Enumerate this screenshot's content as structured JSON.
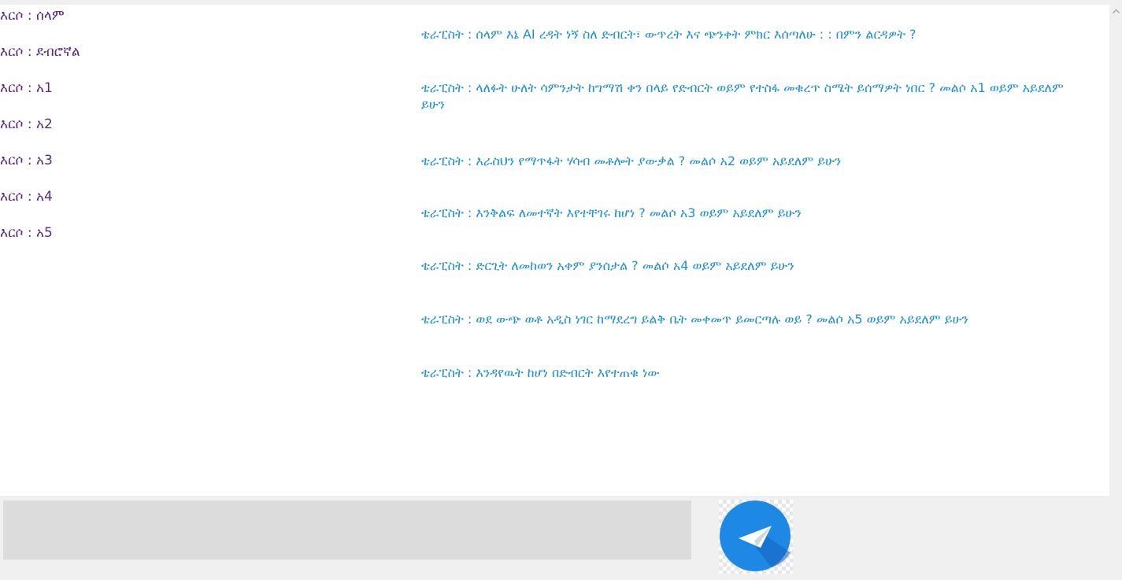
{
  "user_messages": [
    "እርሶ : ሰላም",
    "እርሶ : ደብሮኛል",
    "እርሶ : አ1",
    "እርሶ : አ2",
    "እርሶ : አ3",
    "እርሶ : አ4",
    "እርሶ : አ5"
  ],
  "bot_messages": [
    "ቴራፒስት : ሰላም እኔ AI ረዳት ነኝ ስለ ድብርት፣ ውጥረት እና ጭንቀት ምክር እሰጣለሁ : : በምን ልርዳዎት ?",
    "ቴራፒስት : ላለፉት ሁለት ሳምንታት ከግማሽ ቀን በላይ የድብርት ወይም የተስፋ መቁረጥ ስሜት ይሰማዎት ነበር ? መልሶ አ1 ወይም አይደለም ይሁን",
    "ቴራፒስት : እራስህን የማጥፋት ሃሳብ መቶሎት ያውቃል ? መልሶ አ2 ወይም አይደለም ይሁን",
    "ቴራፒስት : እንቅልፍ ለመተኛት እየተቸገሩ ከሆነ ? መልሶ አ3 ወይም አይደለም ይሁን",
    "ቴራፒስት : ድርጊት ለመከወን አቀም ያንሰታል ? መልሶ አ4 ወይም አይደለም ይሁን",
    "ቴራፒስት : ወደ ውጭ ወቶ አዲስ ነገር ከማደረግ ይልቅ ቤት መቀመጥ ይመርጣሉ ወይ ? መልሶ አ5 ወይም አይደለም ይሁን",
    "ቴራፒስት : እንዳየዉት ከሆነ በድብርት እየተጠቁ ነው"
  ],
  "input": {
    "value": "",
    "placeholder": ""
  },
  "colors": {
    "user_text": "#5b2a86",
    "bot_text": "#1e90d6",
    "send_button": "#1e88e5"
  },
  "icons": {
    "send": "paper-plane-icon",
    "scroll_up": "chevron-up-icon"
  }
}
